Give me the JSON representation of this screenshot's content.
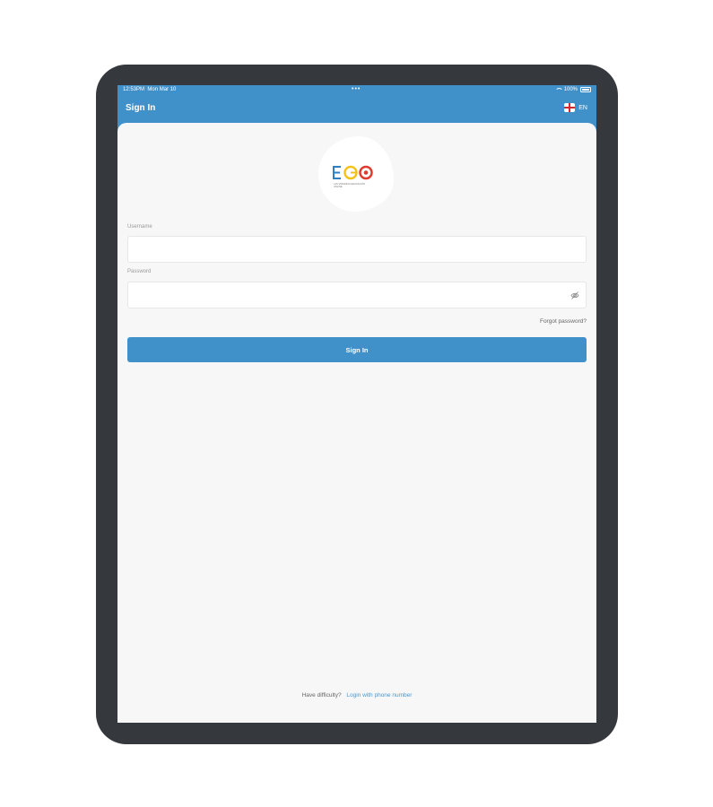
{
  "status_bar": {
    "time": "12:53PM",
    "date": "Mon Mar 10",
    "dots": "•••",
    "battery": "100%"
  },
  "nav": {
    "title": "Sign In",
    "language": "EN"
  },
  "logo": {
    "tagline": "LAS VIRGINIAS EDUCACIÓN ONLINE"
  },
  "form": {
    "username_label": "Username",
    "username_value": "",
    "password_label": "Password",
    "password_value": "",
    "forgot_label": "Forgot password?",
    "signin_label": "Sign In"
  },
  "footer": {
    "help_text": "Have difficulty?",
    "phone_link": "Login with phone number"
  },
  "colors": {
    "primary": "#4090c9",
    "device_frame": "#35383c",
    "background": "#f7f7f7"
  },
  "icons": [
    "wifi-icon",
    "battery-icon",
    "flag-icon",
    "eye-off-icon"
  ]
}
